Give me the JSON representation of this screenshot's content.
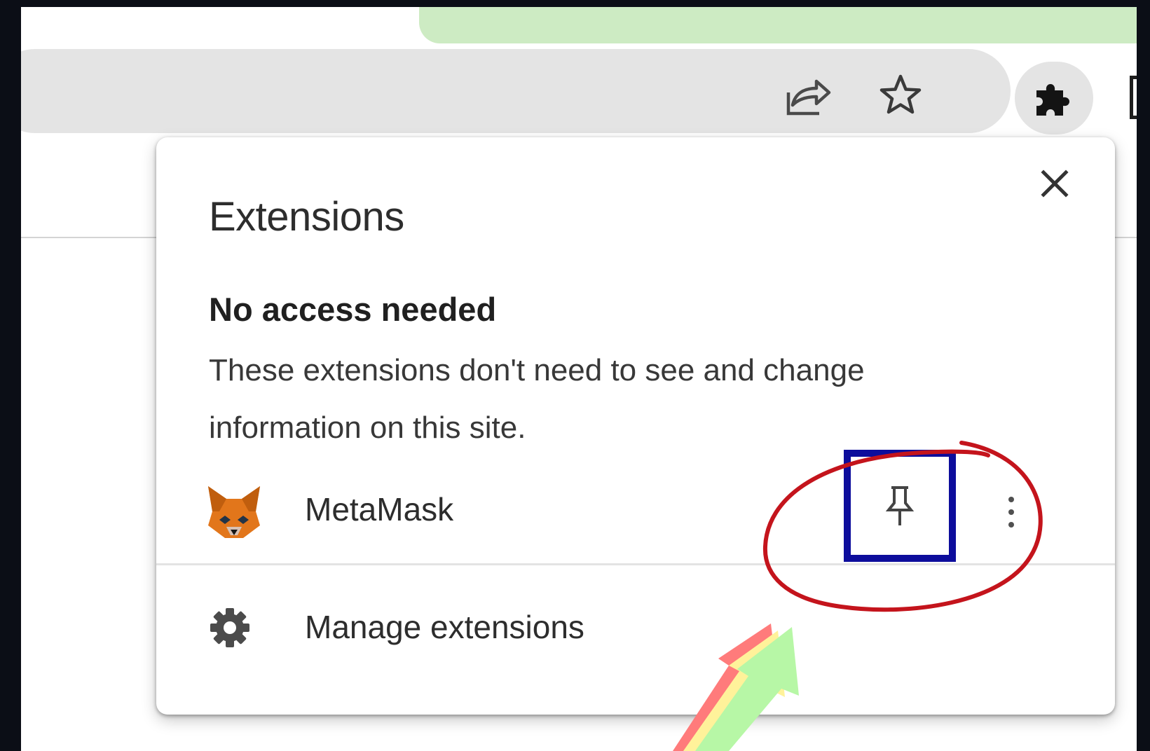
{
  "popup": {
    "title": "Extensions",
    "section_heading": "No access needed",
    "section_description": "These extensions don't need to see and change information on this site.",
    "extensions": [
      {
        "name": "MetaMask",
        "icon": "metamask-fox-icon",
        "pinned": false
      }
    ],
    "manage_label": "Manage extensions"
  },
  "toolbar": {
    "icons": [
      "share-icon",
      "bookmark-star-icon",
      "extensions-puzzle-icon"
    ]
  },
  "colors": {
    "tab_strip": "#cdebc3",
    "omnibox": "#e4e4e4",
    "highlight_box": "#0d0d9c",
    "highlight_circle": "#c4141c",
    "arrow_fill": "#b7f7a6",
    "arrow_mid": "#fff29a",
    "arrow_back": "#ff7b7b"
  }
}
